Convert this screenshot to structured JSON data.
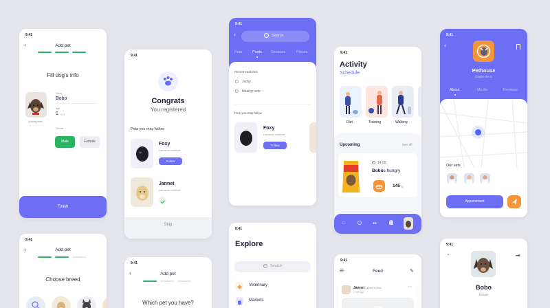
{
  "status_time": "9:41",
  "add_pet_1": {
    "title": "Add pet",
    "heading": "Fill dog's info",
    "name_label": "Name",
    "name_value": "Bobo",
    "age_label": "Age",
    "age_value": "1",
    "age_unit": "Y.O",
    "upload_label": "Upload photo",
    "gender_label": "Gender",
    "male": "Male",
    "female": "Female",
    "finish": "Finish"
  },
  "add_pet_2": {
    "title": "Add pet",
    "heading": "Choose breed"
  },
  "congrats": {
    "title": "Congrats",
    "subtitle": "You registered",
    "section": "Pets you may follow",
    "pets": [
      {
        "name": "Foxy",
        "breed": "Labrador retriever",
        "action": "Follow"
      },
      {
        "name": "Jannet",
        "breed": "Labrador retriever"
      }
    ],
    "skip": "Skip"
  },
  "add_pet_3": {
    "title": "Add pet",
    "question": "Which pet you have?"
  },
  "search_screen": {
    "search_placeholder": "Search",
    "tabs": [
      "Pets",
      "Posts",
      "Services",
      "Places"
    ],
    "active_tab": 1,
    "recent_label": "Recent searches",
    "recent": [
      "Jacky",
      "Nearby vets"
    ],
    "follow_label": "Pets you may follow",
    "pet": {
      "name": "Foxy",
      "breed": "Labrador retriever",
      "action": "Follow"
    }
  },
  "explore": {
    "title": "Explore",
    "search_placeholder": "Search",
    "items": [
      "Veterinary",
      "Markets"
    ]
  },
  "activity": {
    "title": "Activity",
    "subtitle": "Schedule",
    "categories": [
      "Diet",
      "Training",
      "Walking"
    ],
    "upcoming": "Upcoming",
    "see_all": "see all",
    "time": "14:00",
    "event_pet": "Bobo",
    "event_text": "is hungry",
    "amount": "145",
    "unit": "g"
  },
  "feed": {
    "title": "Feed",
    "post_user": "Jannet",
    "post_action": "added a photo",
    "post_time": "2 min ago"
  },
  "pethouse": {
    "name": "Pethouse",
    "address": "Duane 95 st",
    "tabs": [
      "About",
      "Media",
      "Reviews"
    ],
    "active_tab": 0,
    "vets_label": "Our vets",
    "appointment": "Appointment"
  },
  "profile": {
    "name": "Bobo",
    "breed": "Beagle"
  },
  "colors": {
    "primary": "#6c6ef4",
    "green": "#28b55f",
    "orange": "#f5953a",
    "background": "#e5e6ec"
  }
}
